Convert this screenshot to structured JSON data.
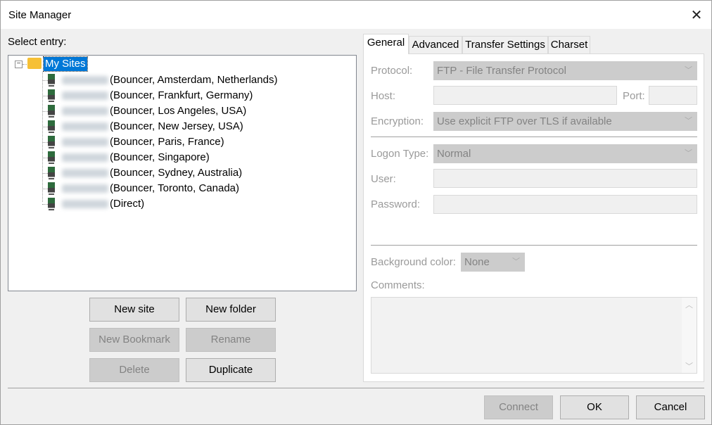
{
  "window": {
    "title": "Site Manager"
  },
  "tree": {
    "label": "Select entry:",
    "root": "My Sites",
    "sites": [
      "(Bouncer, Amsterdam, Netherlands)",
      "(Bouncer, Frankfurt, Germany)",
      "(Bouncer, Los Angeles, USA)",
      "(Bouncer, New Jersey, USA)",
      "(Bouncer, Paris, France)",
      "(Bouncer, Singapore)",
      "(Bouncer, Sydney, Australia)",
      "(Bouncer, Toronto, Canada)",
      "(Direct)"
    ]
  },
  "buttons": {
    "new_site": "New site",
    "new_folder": "New folder",
    "new_bookmark": "New Bookmark",
    "rename": "Rename",
    "delete": "Delete",
    "duplicate": "Duplicate",
    "connect": "Connect",
    "ok": "OK",
    "cancel": "Cancel"
  },
  "tabs": [
    "General",
    "Advanced",
    "Transfer Settings",
    "Charset"
  ],
  "general": {
    "protocol_label": "Protocol:",
    "protocol": "FTP - File Transfer Protocol",
    "host_label": "Host:",
    "port_label": "Port:",
    "encryption_label": "Encryption:",
    "encryption": "Use explicit FTP over TLS if available",
    "logon_label": "Logon Type:",
    "logon": "Normal",
    "user_label": "User:",
    "password_label": "Password:",
    "bgcolor_label": "Background color:",
    "bgcolor": "None",
    "comments_label": "Comments:"
  },
  "colors": {
    "selection": "#0078d7",
    "disabled_field": "#cccccc"
  }
}
